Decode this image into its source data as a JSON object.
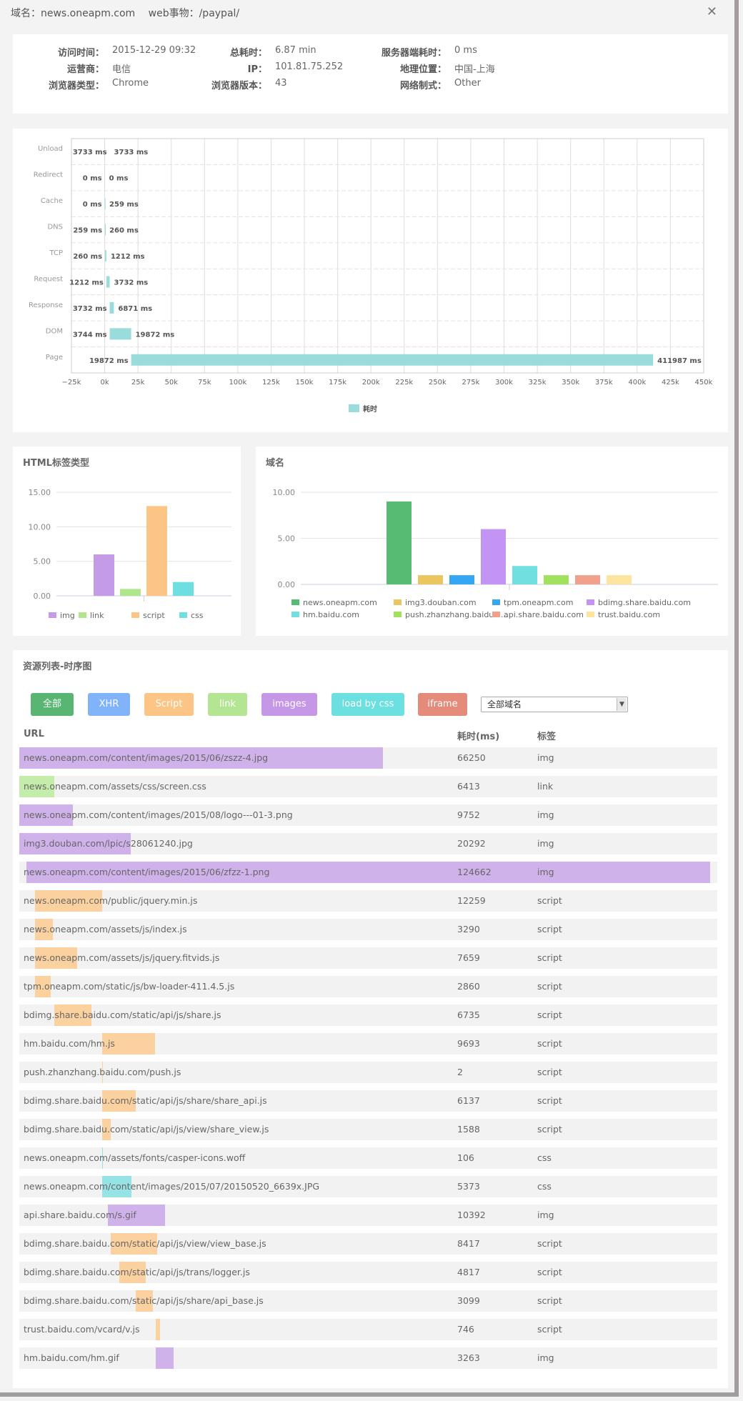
{
  "header": {
    "domain_label": "域名：news.oneapm.com",
    "transaction_label": "web事物：/paypal/",
    "close_icon": "close-icon"
  },
  "info": [
    {
      "label": "访问时间：",
      "value": "2015-12-29 09:32"
    },
    {
      "label": "总耗时：",
      "value": "6.87 min"
    },
    {
      "label": "服务器端耗时：",
      "value": "0 ms"
    },
    {
      "label": "运营商：",
      "value": "电信"
    },
    {
      "label": "IP：",
      "value": "101.81.75.252"
    },
    {
      "label": "地理位置：",
      "value": "中国-上海"
    },
    {
      "label": "浏览器类型：",
      "value": "Chrome"
    },
    {
      "label": "浏览器版本：",
      "value": "43"
    },
    {
      "label": "网络制式：",
      "value": "Other"
    }
  ],
  "chart_data": [
    {
      "type": "bar",
      "orientation": "horizontal",
      "subtype": "waterfall",
      "title": "",
      "categories": [
        "Unload",
        "Redirect",
        "Cache",
        "DNS",
        "TCP",
        "Request",
        "Response",
        "DOM",
        "Page"
      ],
      "series": [
        {
          "name": "耗时",
          "start": [
            3733,
            0,
            0,
            259,
            260,
            1212,
            3732,
            3744,
            19872
          ],
          "end": [
            3733,
            0,
            259,
            260,
            1212,
            3732,
            6871,
            19872,
            411987
          ],
          "start_labels": [
            "3733 ms",
            "0 ms",
            "0 ms",
            "259 ms",
            "260 ms",
            "1212 ms",
            "3732 ms",
            "3744 ms",
            "19872 ms"
          ],
          "end_labels": [
            "3733 ms",
            "0 ms",
            "259 ms",
            "260 ms",
            "1212 ms",
            "3732 ms",
            "6871 ms",
            "19872 ms",
            "411987 ms"
          ],
          "color": "#9adcdc"
        }
      ],
      "xticks": [
        "−25k",
        "0k",
        "25k",
        "50k",
        "75k",
        "100k",
        "125k",
        "150k",
        "175k",
        "200k",
        "225k",
        "250k",
        "275k",
        "300k",
        "325k",
        "350k",
        "375k",
        "400k",
        "425k",
        "450k"
      ],
      "xlim": [
        -25000,
        450000
      ],
      "grid": true,
      "legend": [
        "耗时"
      ],
      "legend_position": "bottom"
    },
    {
      "type": "bar",
      "title": "HTML标签类型",
      "categories": [
        "img",
        "link",
        "script",
        "css"
      ],
      "values": [
        6,
        1,
        13,
        2
      ],
      "colors": [
        "#c39be6",
        "#b0e78e",
        "#fcc586",
        "#6ddfe0"
      ],
      "yticks": [
        "0.00",
        "5.00",
        "10.00",
        "15.00"
      ],
      "ylim": [
        0,
        15
      ],
      "legend_position": "bottom"
    },
    {
      "type": "bar",
      "title": "域名",
      "categories": [
        "news.oneapm.com",
        "img3.douban.com",
        "tpm.oneapm.com",
        "bdimg.share.baidu.com",
        "hm.baidu.com",
        "push.zhanzhang.baidu.com",
        "api.share.baidu.com",
        "trust.baidu.com"
      ],
      "legend_labels": [
        "news.oneapm.com",
        "img3.douban.com",
        "tpm.oneapm.com",
        "bdimg.share.baidu.com",
        "hm.baidu.com",
        "push.zhanzhang.baidu.c...",
        "api.share.baidu.com",
        "trust.baidu.com"
      ],
      "values": [
        9,
        1,
        1,
        6,
        2,
        1,
        1,
        1
      ],
      "colors": [
        "#58bb74",
        "#ebc55e",
        "#34a6f2",
        "#c394f3",
        "#71dfe0",
        "#a2e15e",
        "#f1a18b",
        "#fde5a0"
      ],
      "yticks": [
        "0.00",
        "5.00",
        "10.00"
      ],
      "ylim": [
        0,
        10
      ],
      "legend_position": "bottom"
    }
  ],
  "resources": {
    "title": "资源列表-时序图",
    "filters": [
      {
        "label": "全部",
        "color": "#58b672"
      },
      {
        "label": "XHR",
        "color": "#80b3fa"
      },
      {
        "label": "Script",
        "color": "#fcc586"
      },
      {
        "label": "link",
        "color": "#b3e592"
      },
      {
        "label": "images",
        "color": "#c597e6"
      },
      {
        "label": "load by css",
        "color": "#6cdfe0"
      },
      {
        "label": "iframe",
        "color": "#e48b7c"
      }
    ],
    "domain_select": {
      "value": "全部域名",
      "arrow_icon": "chevron-down-icon"
    },
    "columns": {
      "url": "URL",
      "duration": "耗时(ms)",
      "tag": "标签"
    },
    "tag_colors": {
      "img": "#d0b2eb",
      "link": "#c4ecaa",
      "script": "#fbd29f",
      "css": "#95e3e5"
    },
    "rows": [
      {
        "url": "news.oneapm.com/content/images/2015/06/zszz-4.jpg",
        "duration": 66250,
        "tag": "img",
        "start": 0
      },
      {
        "url": "news.oneapm.com/assets/css/screen.css",
        "duration": 6413,
        "tag": "link",
        "start": 0
      },
      {
        "url": "news.oneapm.com/content/images/2015/08/logo---01-3.png",
        "duration": 9752,
        "tag": "img",
        "start": 0
      },
      {
        "url": "img3.douban.com/lpic/s28061240.jpg",
        "duration": 20292,
        "tag": "img",
        "start": 0
      },
      {
        "url": "news.oneapm.com/content/images/2015/06/zfzz-1.png",
        "duration": 124662,
        "tag": "img",
        "start": 1300
      },
      {
        "url": "news.oneapm.com/public/jquery.min.js",
        "duration": 12259,
        "tag": "script",
        "start": 2865
      },
      {
        "url": "news.oneapm.com/assets/js/index.js",
        "duration": 3290,
        "tag": "script",
        "start": 2865
      },
      {
        "url": "news.oneapm.com/assets/js/jquery.fitvids.js",
        "duration": 7659,
        "tag": "script",
        "start": 2865
      },
      {
        "url": "tpm.oneapm.com/static/js/bw-loader-411.4.5.js",
        "duration": 2860,
        "tag": "script",
        "start": 2865
      },
      {
        "url": "bdimg.share.baidu.com/static/api/js/share.js",
        "duration": 6735,
        "tag": "script",
        "start": 6380
      },
      {
        "url": "hm.baidu.com/hm.js",
        "duration": 9693,
        "tag": "script",
        "start": 15100
      },
      {
        "url": "push.zhanzhang.baidu.com/push.js",
        "duration": 2,
        "tag": "script",
        "start": 15100
      },
      {
        "url": "bdimg.share.baidu.com/static/api/js/share/share_api.js",
        "duration": 6137,
        "tag": "script",
        "start": 15100
      },
      {
        "url": "bdimg.share.baidu.com/static/api/js/view/share_view.js",
        "duration": 1588,
        "tag": "script",
        "start": 15100
      },
      {
        "url": "news.oneapm.com/assets/fonts/casper-icons.woff",
        "duration": 106,
        "tag": "css",
        "start": 15100
      },
      {
        "url": "news.oneapm.com/content/images/2015/07/20150520_6639x.JPG",
        "duration": 5373,
        "tag": "css",
        "start": 15100
      },
      {
        "url": "api.share.baidu.com/s.gif",
        "duration": 10392,
        "tag": "img",
        "start": 16150
      },
      {
        "url": "bdimg.share.baidu.com/static/api/js/view/view_base.js",
        "duration": 8417,
        "tag": "script",
        "start": 16670
      },
      {
        "url": "bdimg.share.baidu.com/static/api/js/trans/logger.js",
        "duration": 4817,
        "tag": "script",
        "start": 18230
      },
      {
        "url": "bdimg.share.baidu.com/static/api/js/share/api_base.js",
        "duration": 3099,
        "tag": "script",
        "start": 21220
      },
      {
        "url": "trust.baidu.com/vcard/v.js",
        "duration": 746,
        "tag": "script",
        "start": 24870
      },
      {
        "url": "hm.baidu.com/hm.gif",
        "duration": 3263,
        "tag": "img",
        "start": 24870
      }
    ]
  }
}
